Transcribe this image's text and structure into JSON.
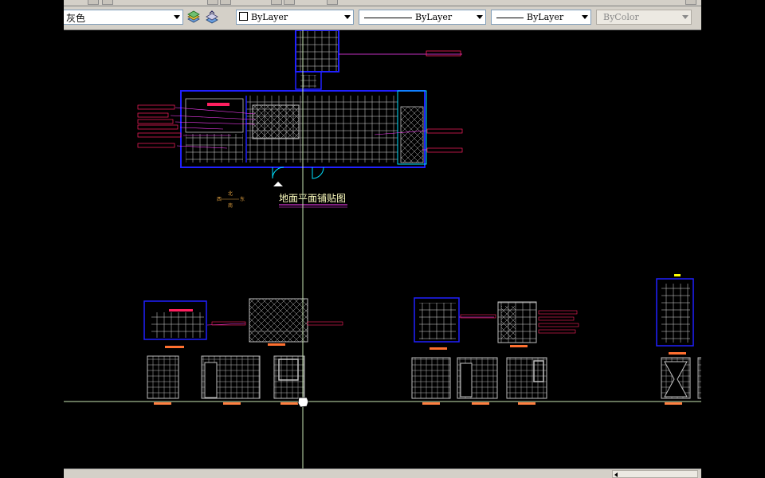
{
  "toolbar": {
    "color_scheme_label": "灰色",
    "layer_color_value": "ByLayer",
    "linetype_value": "ByLayer",
    "lineweight_value": "ByLayer",
    "plot_style_value": "ByColor"
  },
  "drawing": {
    "plan_title": "地面平面铺贴图",
    "compass_north": "北",
    "compass_east": "东",
    "compass_south": "南",
    "compass_west": "西"
  },
  "colors": {
    "canvas_bg": "#000000",
    "wall": "#2020ff",
    "tile": "#c8c8c8",
    "annotation": "#ff2060",
    "leader": "#ff40ff",
    "crosshair": "#c8e6b4",
    "cyan": "#00e0ff",
    "yellow": "#ffff00",
    "orange": "#ffa000",
    "toolbar_bg": "#d4d0c8"
  }
}
